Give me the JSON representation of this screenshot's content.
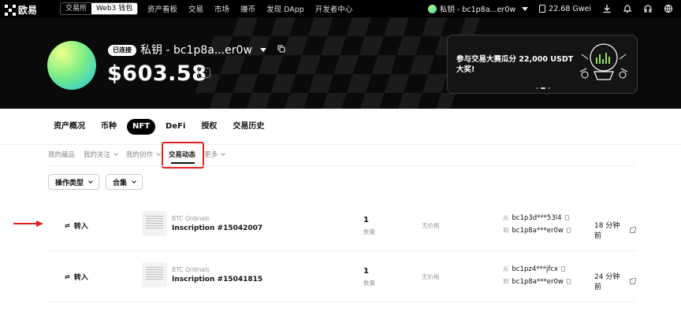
{
  "topnav": {
    "logo_text": "欧易",
    "segment": [
      "交易所",
      "Web3 钱包"
    ],
    "links": [
      "资产看板",
      "交易",
      "市场",
      "赚币",
      "发现 DApp",
      "开发者中心"
    ],
    "wallet": "私钥 - bc1p8a...er0w",
    "gas": "22.68 Gwei",
    "icons": [
      "download-icon",
      "bell-icon",
      "headset-icon",
      "globe-icon"
    ]
  },
  "hero": {
    "badge": "已连接",
    "wallet_name": "私钥 - bc1p8a...er0w",
    "balance": "$603.58",
    "more": "···",
    "promo_text": "参与交易大赛瓜分 22,000 USDT 大奖!"
  },
  "tabs": [
    "资产概况",
    "币种",
    "NFT",
    "DeFi",
    "授权",
    "交易历史"
  ],
  "subtabs": [
    "我的藏品",
    "我的关注",
    "我的创作",
    "交易动态",
    "更多"
  ],
  "filters": [
    "操作类型",
    "合集"
  ],
  "rows": [
    {
      "type": "转入",
      "collection": "BTC Ordinals",
      "name": "Inscription #15042007",
      "qty": "1",
      "qty_label": "数量",
      "price": "无价格",
      "from_label": "从",
      "from": "bc1p3d***53l4",
      "to_label": "到",
      "to": "bc1p8a***er0w",
      "time": "18 分钟前"
    },
    {
      "type": "转入",
      "collection": "BTC Ordinals",
      "name": "Inscription #15041815",
      "qty": "1",
      "qty_label": "数量",
      "price": "无价格",
      "from_label": "从",
      "from": "bc1pz4***jfcx",
      "to_label": "到",
      "to": "bc1p8a***er0w",
      "time": "24 分钟前"
    }
  ],
  "colors": {
    "accent_red": "#e02020",
    "background_dark": "#000000"
  }
}
